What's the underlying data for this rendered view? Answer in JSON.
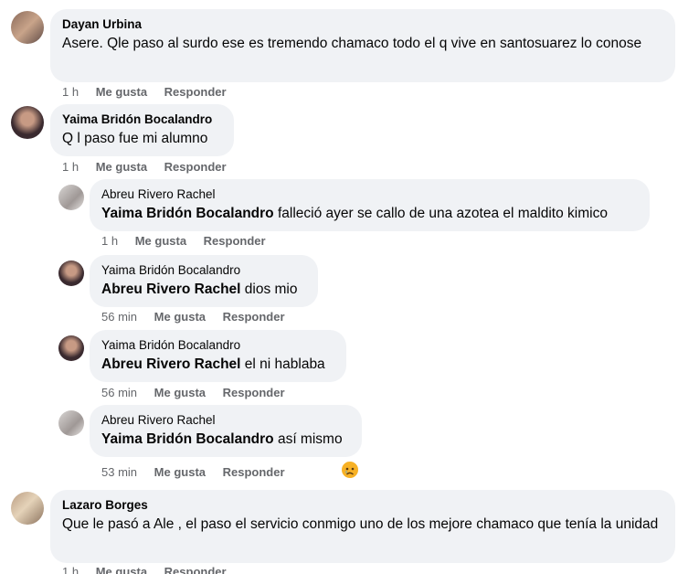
{
  "comments": [
    {
      "author": "Dayan Urbina",
      "text": "Asere. Qle paso al surdo ese es tremendo chamaco todo el q vive en santosuarez lo conose",
      "time": "1 h",
      "like": "Me gusta",
      "reply": "Responder"
    },
    {
      "author": "Yaima Bridón Bocalandro",
      "text": "Q l paso fue mi alumno",
      "time": "1 h",
      "like": "Me gusta",
      "reply": "Responder"
    },
    {
      "author": "Abreu Rivero Rachel",
      "mention": "Yaima Bridón Bocalandro",
      "text": " falleció ayer se callo de una azotea el maldito kimico",
      "time": "1 h",
      "like": "Me gusta",
      "reply": "Responder"
    },
    {
      "author": "Yaima Bridón Bocalandro",
      "mention": "Abreu Rivero Rachel",
      "text": " dios mio",
      "time": "56 min",
      "like": "Me gusta",
      "reply": "Responder"
    },
    {
      "author": "Yaima Bridón Bocalandro",
      "mention": "Abreu Rivero Rachel",
      "text": " el ni hablaba",
      "time": "56 min",
      "like": "Me gusta",
      "reply": "Responder"
    },
    {
      "author": "Abreu Rivero Rachel",
      "mention": "Yaima Bridón Bocalandro",
      "text": " así mismo",
      "time": "53 min",
      "like": "Me gusta",
      "reply": "Responder",
      "reaction": "sad-face-icon"
    },
    {
      "author": "Lazaro Borges",
      "text": "Que le pasó a Ale , el paso el servicio conmigo uno de los mejore chamaco que tenía la unidad",
      "time": "1 h",
      "like": "Me gusta",
      "reply": "Responder"
    }
  ],
  "colors": {
    "bubble": "#f0f2f5",
    "meta": "#65676b",
    "text": "#050505",
    "reaction": "#f7b125"
  }
}
